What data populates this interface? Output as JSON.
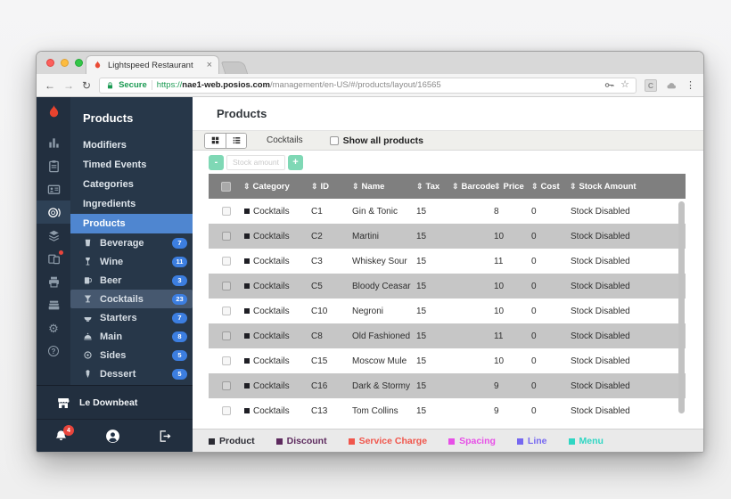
{
  "icons": {
    "back": "←",
    "forward": "→",
    "reload": "↻",
    "menu": "⋮",
    "star": "☆",
    "close": "×",
    "sort": "⇕",
    "gear": "⚙",
    "help": "?",
    "minus": "-",
    "plus": "+"
  },
  "browser": {
    "tab_title": "Lightspeed Restaurant",
    "secure_label": "Secure",
    "url_protocol": "https://",
    "url_host": "nae1-web.posios.com",
    "url_path": "/management/en-US/#/products/layout/16565",
    "extension_label": "C"
  },
  "sidebar": {
    "title": "Products",
    "items": [
      {
        "label": "Modifiers"
      },
      {
        "label": "Timed Events"
      },
      {
        "label": "Categories"
      },
      {
        "label": "Ingredients"
      },
      {
        "label": "Products"
      }
    ],
    "categories": [
      {
        "label": "Beverage",
        "count": "7"
      },
      {
        "label": "Wine",
        "count": "11"
      },
      {
        "label": "Beer",
        "count": "3"
      },
      {
        "label": "Cocktails",
        "count": "23"
      },
      {
        "label": "Starters",
        "count": "7"
      },
      {
        "label": "Main",
        "count": "8"
      },
      {
        "label": "Sides",
        "count": "5"
      },
      {
        "label": "Dessert",
        "count": "5"
      }
    ],
    "account": {
      "business_name": "Le Downbeat",
      "notification_count": "4"
    }
  },
  "main": {
    "page_title": "Products",
    "toolbar": {
      "category_filter": "Cocktails",
      "show_all_label": "Show all products"
    },
    "stepper": {
      "placeholder": "Stock amount"
    },
    "table": {
      "columns": [
        "Category",
        "ID",
        "Name",
        "Tax",
        "Barcode",
        "Price",
        "Cost",
        "Stock Amount"
      ],
      "rows": [
        {
          "category": "Cocktails",
          "id": "C1",
          "name": "Gin & Tonic",
          "tax": "15",
          "barcode": "",
          "price": "8",
          "cost": "0",
          "stock": "Stock Disabled"
        },
        {
          "category": "Cocktails",
          "id": "C2",
          "name": "Martini",
          "tax": "15",
          "barcode": "",
          "price": "10",
          "cost": "0",
          "stock": "Stock Disabled"
        },
        {
          "category": "Cocktails",
          "id": "C3",
          "name": "Whiskey Sour",
          "tax": "15",
          "barcode": "",
          "price": "11",
          "cost": "0",
          "stock": "Stock Disabled"
        },
        {
          "category": "Cocktails",
          "id": "C5",
          "name": "Bloody Ceasar",
          "tax": "15",
          "barcode": "",
          "price": "10",
          "cost": "0",
          "stock": "Stock Disabled"
        },
        {
          "category": "Cocktails",
          "id": "C10",
          "name": "Negroni",
          "tax": "15",
          "barcode": "",
          "price": "10",
          "cost": "0",
          "stock": "Stock Disabled"
        },
        {
          "category": "Cocktails",
          "id": "C8",
          "name": "Old Fashioned",
          "tax": "15",
          "barcode": "",
          "price": "11",
          "cost": "0",
          "stock": "Stock Disabled"
        },
        {
          "category": "Cocktails",
          "id": "C15",
          "name": "Moscow Mule",
          "tax": "15",
          "barcode": "",
          "price": "10",
          "cost": "0",
          "stock": "Stock Disabled"
        },
        {
          "category": "Cocktails",
          "id": "C16",
          "name": "Dark & Stormy",
          "tax": "15",
          "barcode": "",
          "price": "9",
          "cost": "0",
          "stock": "Stock Disabled"
        },
        {
          "category": "Cocktails",
          "id": "C13",
          "name": "Tom Collins",
          "tax": "15",
          "barcode": "",
          "price": "9",
          "cost": "0",
          "stock": "Stock Disabled"
        }
      ]
    },
    "legend": {
      "items": [
        {
          "label": "Product",
          "color": "#2b2b33"
        },
        {
          "label": "Discount",
          "color": "#5d2a5e"
        },
        {
          "label": "Service Charge",
          "color": "#f0564c"
        },
        {
          "label": "Spacing",
          "color": "#e74fe7"
        },
        {
          "label": "Line",
          "color": "#7668f0"
        },
        {
          "label": "Menu",
          "color": "#2fd6c3"
        }
      ]
    }
  },
  "colors": {
    "brand_red": "#ea4b35",
    "selected_blue": "#4f86d0",
    "badge_blue": "#3c7ee0",
    "stepper_teal": "#7fd8b5",
    "secure_green": "#1a9a52"
  }
}
